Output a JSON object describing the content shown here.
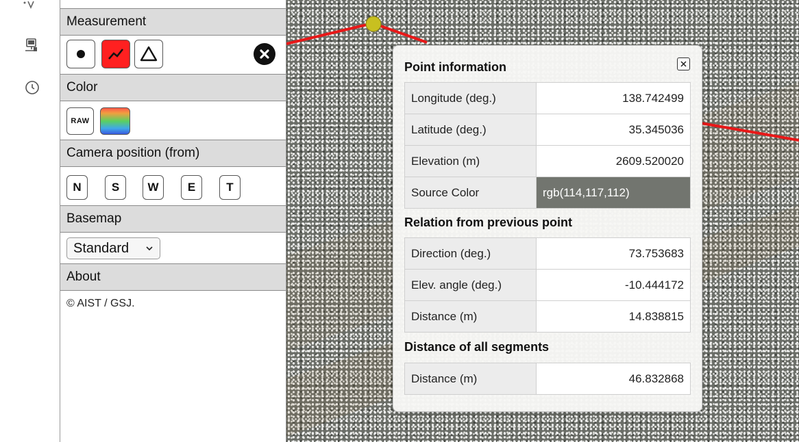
{
  "sidebar": {
    "measurement_title": "Measurement",
    "color_title": "Color",
    "color_raw_label": "RAW",
    "camera_title": "Camera position (from)",
    "camera_buttons": [
      "N",
      "S",
      "W",
      "E",
      "T"
    ],
    "basemap_title": "Basemap",
    "basemap_value": "Standard",
    "about_title": "About",
    "about_text": "© AIST / GSJ."
  },
  "popup": {
    "point_title": "Point information",
    "point_rows": [
      {
        "label": "Longitude (deg.)",
        "value": "138.742499"
      },
      {
        "label": "Latitude (deg.)",
        "value": "35.345036"
      },
      {
        "label": "Elevation (m)",
        "value": "2609.520020"
      },
      {
        "label": "Source Color",
        "value": "rgb(114,117,112)"
      }
    ],
    "relation_title": "Relation from previous point",
    "relation_rows": [
      {
        "label": "Direction (deg.)",
        "value": "73.753683"
      },
      {
        "label": "Elev. angle (deg.)",
        "value": "-10.444172"
      },
      {
        "label": "Distance (m)",
        "value": "14.838815"
      }
    ],
    "segments_title": "Distance of all segments",
    "segments_rows": [
      {
        "label": "Distance (m)",
        "value": "46.832868"
      }
    ]
  },
  "colors": {
    "active_tool": "#ff2020",
    "measure_line": "#e81818",
    "point_marker": "#c8c020",
    "source_color_swatch": "#727570"
  },
  "icons": {
    "rail": [
      "view-icon",
      "pc-icon",
      "history-icon"
    ],
    "measurement_tools": [
      "point-icon",
      "polyline-icon",
      "triangle-icon"
    ],
    "close": "close-icon"
  }
}
